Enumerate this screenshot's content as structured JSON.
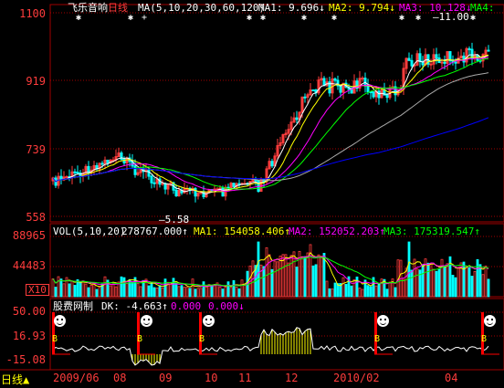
{
  "price_panel": {
    "stock_name": "飞乐音响",
    "period": "日线",
    "ma_params": "MA(5,10,20,30,60,120)",
    "ma1": "MA1: 9.696↓",
    "ma2": "MA2: 9.794↓",
    "ma3": "MA3: 10.128↓",
    "ma4": "MA4:",
    "y_ticks": [
      "1100",
      "919",
      "739",
      "558"
    ],
    "high_annotation": "—11.00",
    "low_annotation": "—5.58",
    "signal_glyph": "✱"
  },
  "volume_panel": {
    "params": "VOL(5,10,20)",
    "vol_value": "278767.000↑",
    "ma1": "MA1: 154058.406↑",
    "ma2": "MA2: 152052.203↑",
    "ma3": "MA3: 175319.547↑",
    "y_ticks": [
      "88965",
      "44483"
    ],
    "unit": "X10"
  },
  "indicator_panel": {
    "name": "股费网制",
    "dk": "DK: -4.663↑",
    "v2": "0.000",
    "v3": "0.000↓",
    "y_ticks": [
      "50.00",
      "16.93",
      "-15.08"
    ],
    "buy_mark": "B"
  },
  "x_axis": {
    "tab": "日线",
    "ticks": [
      "2009/06",
      "08",
      "09",
      "10",
      "11",
      "12",
      "2010/02",
      "04"
    ]
  },
  "colors": {
    "up": "#ff3c3c",
    "down": "#00ffff",
    "ma1": "#ffffff",
    "ma2": "#ffff00",
    "ma3": "#ff00ff",
    "ma4": "#00ff00",
    "ma6": "#0000ff",
    "grid": "#a00000"
  }
}
